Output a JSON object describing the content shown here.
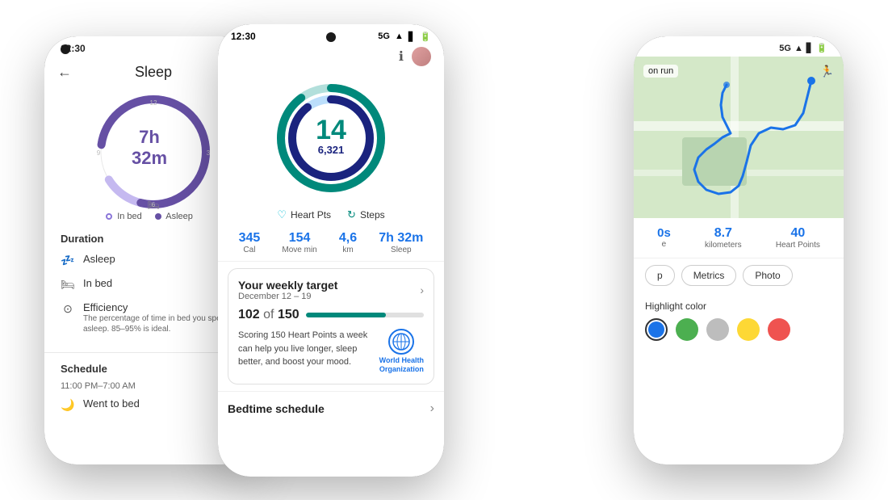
{
  "phones": {
    "left": {
      "title": "Sleep",
      "status_time": "12:30",
      "sleep_duration": "7h 32m",
      "legend": {
        "inbed": "In bed",
        "asleep": "Asleep"
      },
      "sections": {
        "duration_title": "Duration",
        "items": [
          {
            "icon": "zzz",
            "label": "Asleep",
            "desc": ""
          },
          {
            "icon": "bed",
            "label": "In bed",
            "desc": ""
          },
          {
            "icon": "efficiency",
            "label": "Efficiency",
            "desc": "The percentage of time in bed you spent asleep. 85–95% is ideal."
          }
        ]
      },
      "schedule_title": "Schedule",
      "schedule_time": "11:00 PM–7:00 AM",
      "went_to_bed": "Went to bed"
    },
    "center": {
      "status_time": "12:30",
      "status_signal": "5G",
      "ring": {
        "outer_value": 14,
        "inner_value": "6,321"
      },
      "legends": [
        {
          "icon": "heart",
          "label": "Heart Pts"
        },
        {
          "icon": "steps",
          "label": "Steps"
        }
      ],
      "stats": [
        {
          "value": "345",
          "label": "Cal"
        },
        {
          "value": "154",
          "label": "Move min"
        },
        {
          "value": "4,6",
          "label": "km"
        },
        {
          "value": "7h 32m",
          "label": "Sleep"
        }
      ],
      "weekly_target": {
        "title": "Your weekly target",
        "date_range": "December 12 – 19",
        "progress_current": "102",
        "progress_of": "of",
        "progress_total": "150",
        "progress_percent": 68,
        "description": "Scoring 150 Heart Points a week can help you live longer, sleep better, and boost your mood.",
        "who_label": "World Health Organization"
      },
      "bedtime_label": "Bedtime schedule"
    },
    "right": {
      "status_signal": "5G",
      "map_label": "on run",
      "stats": [
        {
          "value": "8.7",
          "label": "kilometers"
        },
        {
          "value": "40",
          "label": "Heart Points"
        }
      ],
      "tabs": [
        "p",
        "Metrics",
        "Photo"
      ],
      "highlight_label": "Highlight color",
      "colors": [
        {
          "color": "#1a73e8",
          "selected": true
        },
        {
          "color": "#4caf50",
          "selected": false
        },
        {
          "color": "#bdbdbd",
          "selected": false
        },
        {
          "color": "#fdd835",
          "selected": false
        },
        {
          "color": "#ef5350",
          "selected": false
        }
      ]
    }
  }
}
